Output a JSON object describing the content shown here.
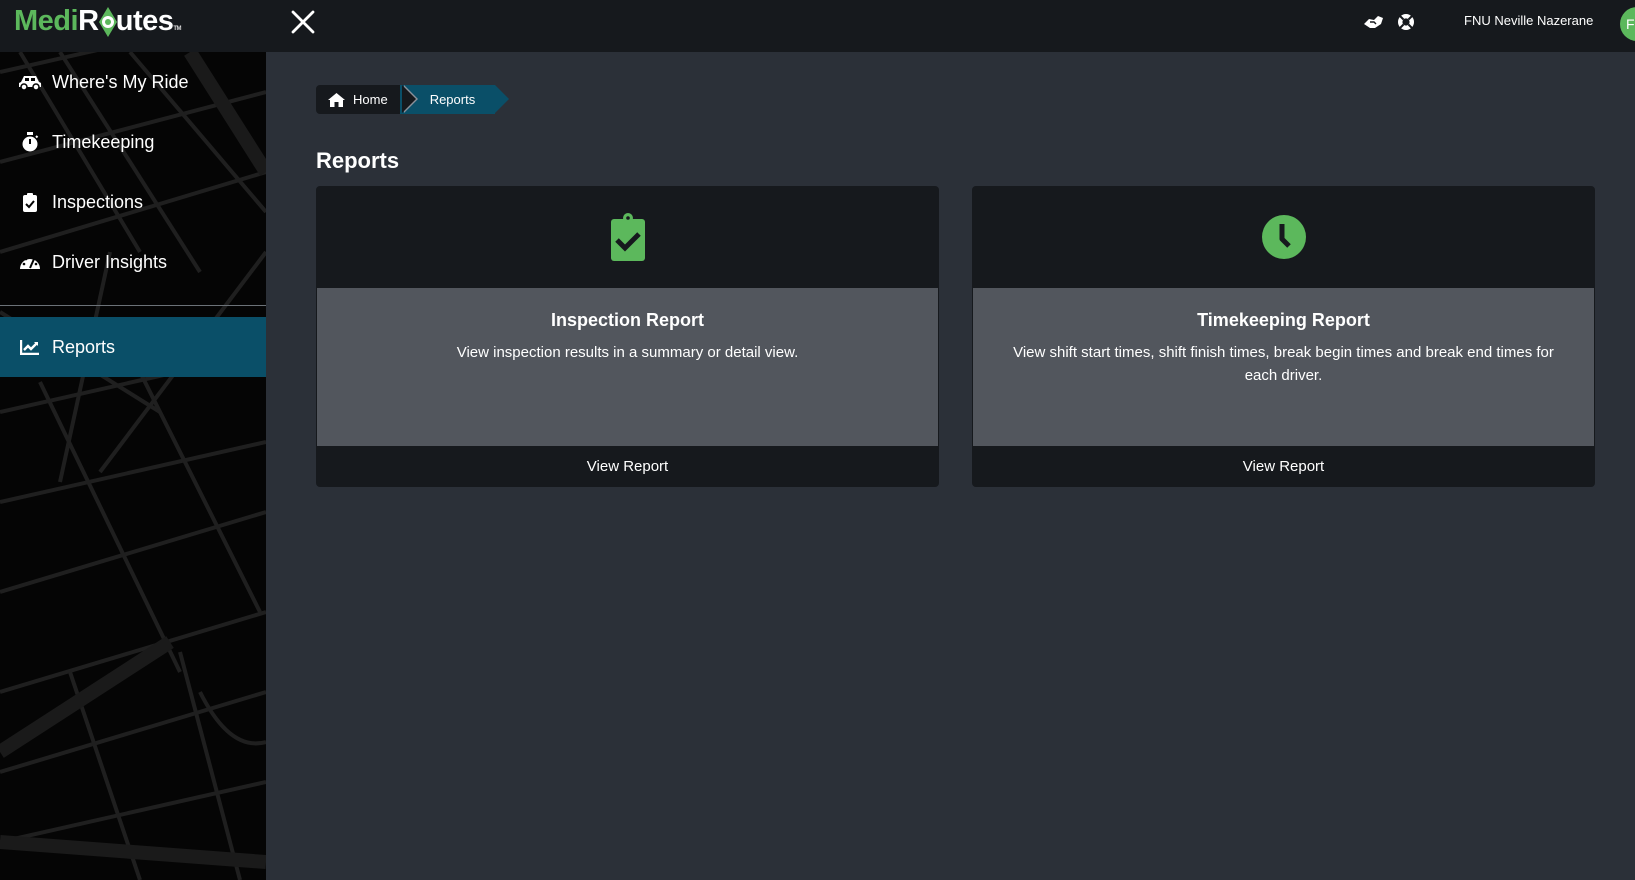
{
  "header": {
    "logo": {
      "part1": "Medi",
      "part2": "R",
      "part3": "utes",
      "tm": "TM"
    },
    "user_name": "FNU Neville Nazerane",
    "avatar_initials": "FN",
    "icons": [
      "close-icon",
      "handshake-icon",
      "life-ring-icon"
    ]
  },
  "sidebar": {
    "items": [
      {
        "label": "Where's My Ride",
        "icon": "car-icon",
        "active": false
      },
      {
        "label": "Timekeeping",
        "icon": "stopwatch-icon",
        "active": false
      },
      {
        "label": "Inspections",
        "icon": "clipboard-check-icon",
        "active": false
      },
      {
        "label": "Driver Insights",
        "icon": "tachometer-icon",
        "active": false
      },
      {
        "label": "Reports",
        "icon": "chart-line-icon",
        "active": true
      }
    ]
  },
  "breadcrumb": {
    "home": "Home",
    "current": "Reports"
  },
  "main": {
    "title": "Reports",
    "cards": [
      {
        "icon": "clipboard-check-icon",
        "title": "Inspection Report",
        "description": "View inspection results in a summary or detail view.",
        "action": "View Report"
      },
      {
        "icon": "clock-icon",
        "title": "Timekeeping Report",
        "description": "View shift start times, shift finish times, break begin times and break end times for each driver.",
        "action": "View Report"
      }
    ]
  },
  "colors": {
    "accent_green": "#5cb85c",
    "active_teal": "#0a4f68",
    "topbar_bg": "#16191d",
    "content_bg": "#2b3038",
    "card_body_bg": "#52565d"
  }
}
